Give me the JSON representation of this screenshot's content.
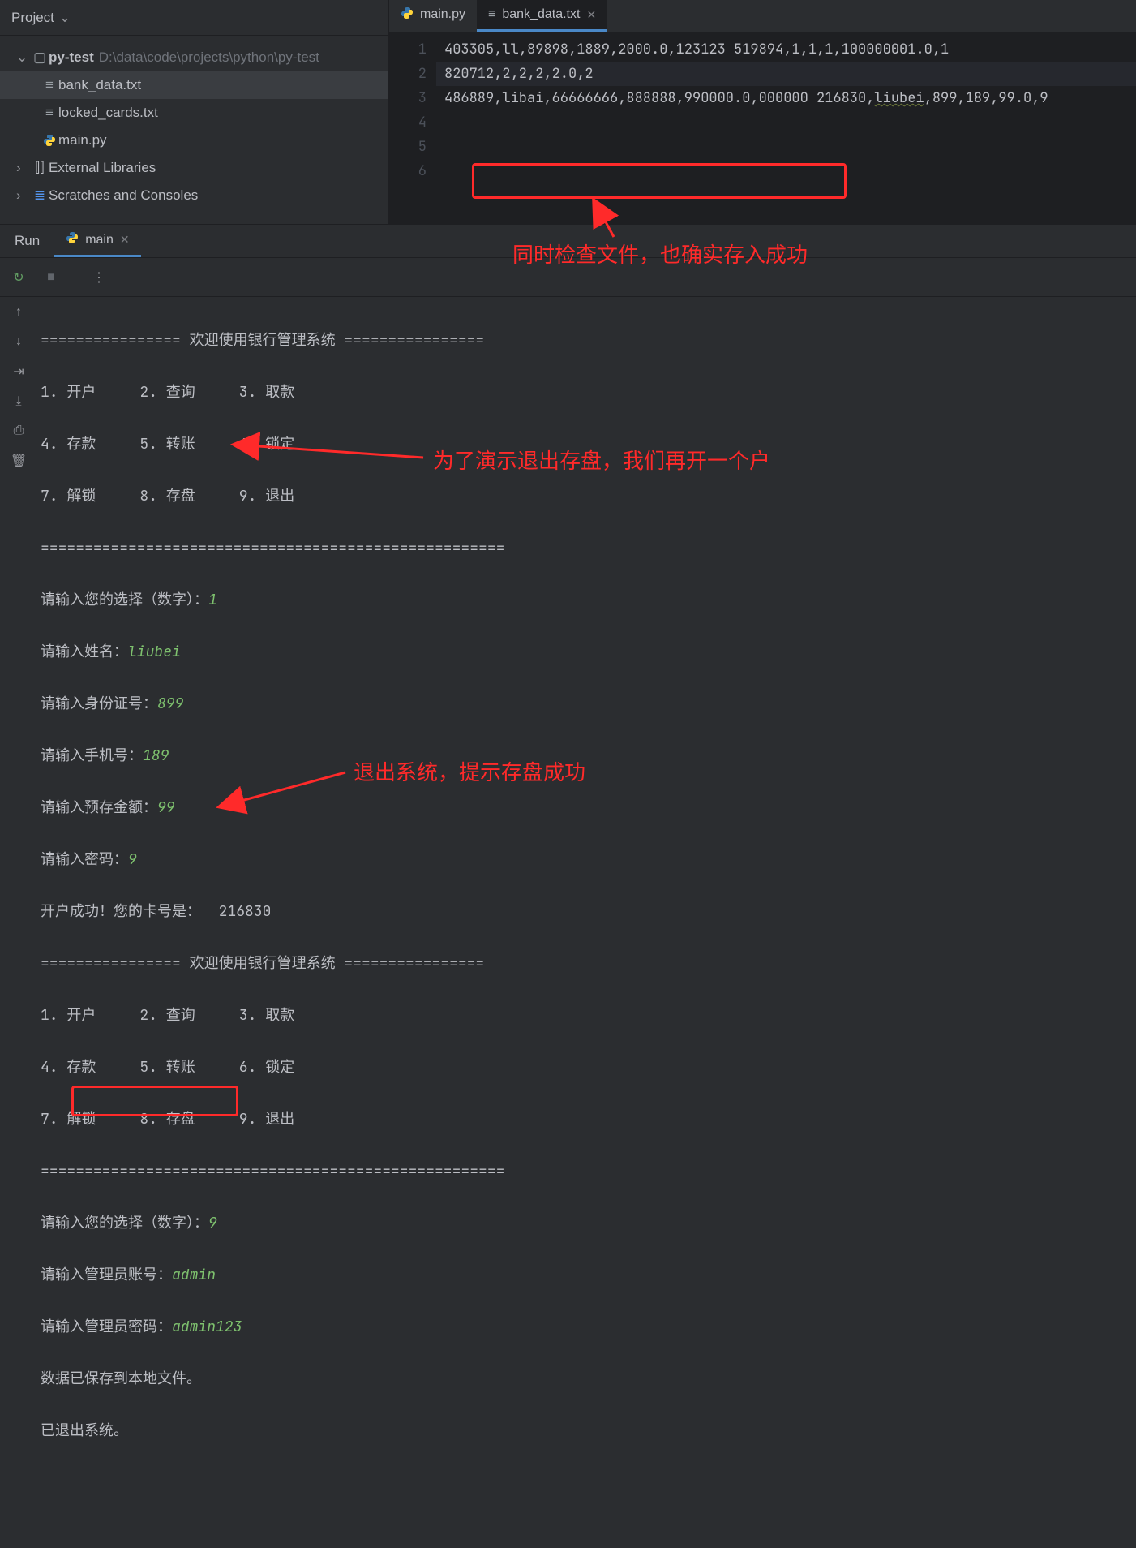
{
  "project": {
    "tool_label": "Project",
    "root_name": "py-test",
    "root_path": "D:\\data\\code\\projects\\python\\py-test",
    "files": [
      "bank_data.txt",
      "locked_cards.txt",
      "main.py"
    ],
    "external_libs": "External Libraries",
    "scratches": "Scratches and Consoles"
  },
  "editor": {
    "tabs": [
      {
        "label": "main.py",
        "icon": "python"
      },
      {
        "label": "bank_data.txt",
        "icon": "text",
        "active": true
      }
    ],
    "lines": [
      "403305,ll,89898,1889,2000.0,123123",
      "519894,1,1,1,100000001.0,1",
      "820712,2,2,2,2.0,2",
      "486889,libai,66666666,888888,990000.0,000000",
      "216830,liubei,899,189,99.0,9",
      ""
    ]
  },
  "run": {
    "tool_label": "Run",
    "tab_label": "main"
  },
  "console": {
    "banner_eq": "================",
    "banner_text": " 欢迎使用银行管理系统 ",
    "menu": [
      "1. 开户     2. 查询     3. 取款",
      "4. 存款     5. 转账     6. 锁定",
      "7. 解锁     8. 存盘     9. 退出"
    ],
    "sep": "=====================================================",
    "prompt_choice": "请输入您的选择（数字）：",
    "choice1": "1",
    "prompt_name": "请输入姓名：",
    "val_name": "liubei",
    "prompt_id": "请输入身份证号：",
    "val_id": "899",
    "prompt_phone": "请输入手机号：",
    "val_phone": "189",
    "prompt_deposit": "请输入预存金额：",
    "val_deposit": "99",
    "prompt_pwd": "请输入密码：",
    "val_pwd": "9",
    "open_ok": "开户成功！您的卡号是：  216830",
    "choice9": "9",
    "prompt_admin_user": "请输入管理员账号：",
    "val_admin_user": "admin",
    "prompt_admin_pwd": "请输入管理员密码：",
    "val_admin_pwd": "admin123",
    "saved": "数据已保存到本地文件。",
    "exited": "已退出系统。"
  },
  "annotations": {
    "a1": "同时检查文件，也确实存入成功",
    "a2": "为了演示退出存盘，我们再开一个户",
    "a3": "退出系统，提示存盘成功"
  }
}
